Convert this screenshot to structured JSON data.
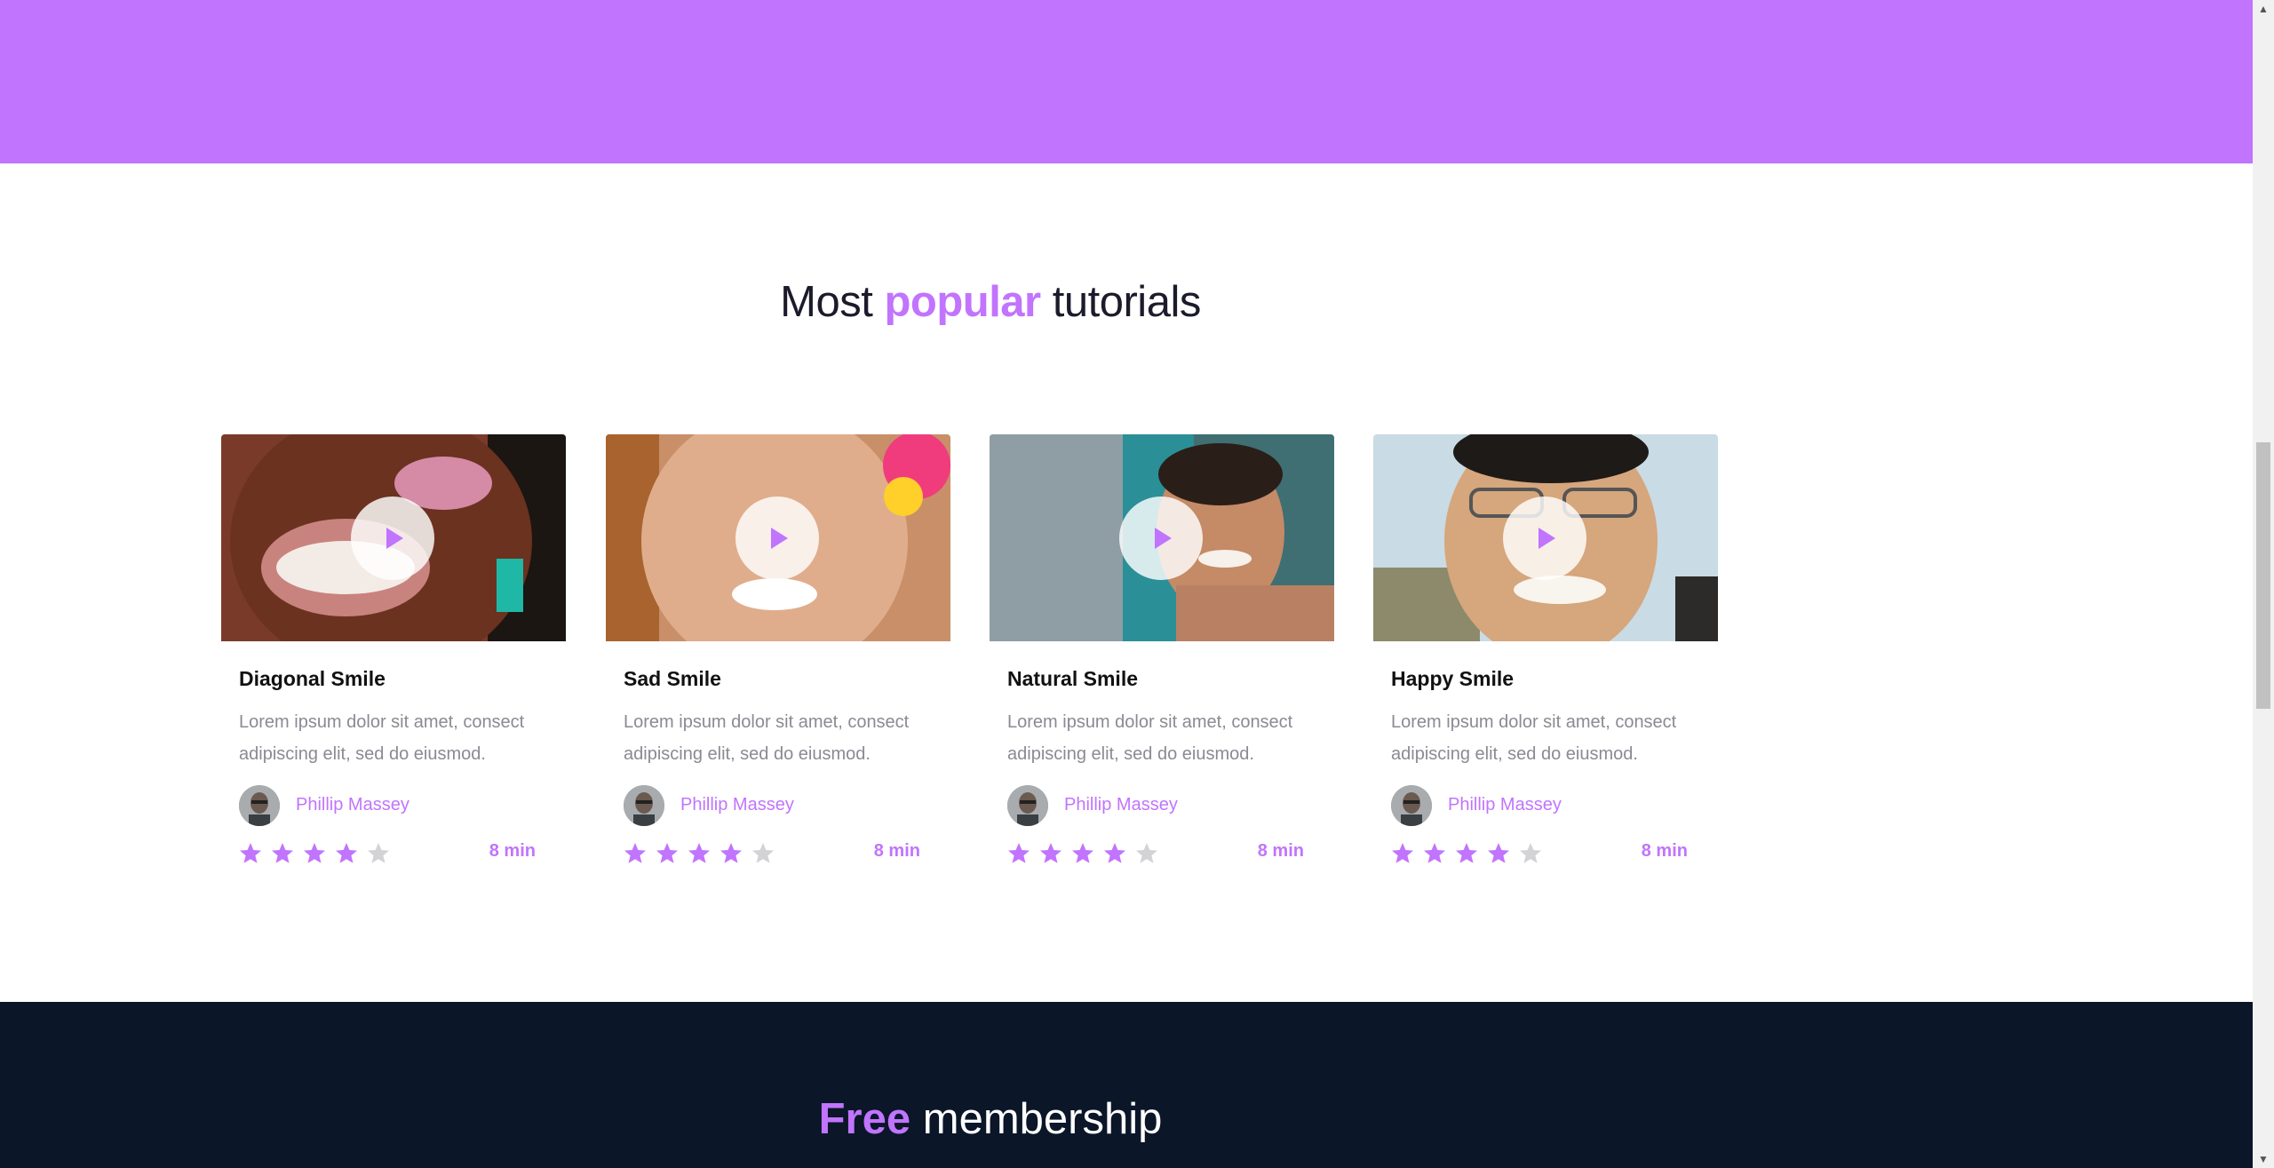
{
  "section": {
    "title_pre": "Most ",
    "title_accent": "popular",
    "title_post": " tutorials"
  },
  "cards": [
    {
      "title": "Diagonal Smile",
      "desc": "Lorem ipsum dolor sit amet, consect adipiscing elit, sed do eiusmod.",
      "author": "Phillip Massey",
      "rating": 4,
      "rating_max": 5,
      "duration": "8 min"
    },
    {
      "title": "Sad Smile",
      "desc": "Lorem ipsum dolor sit amet, consect adipiscing elit, sed do eiusmod.",
      "author": "Phillip Massey",
      "rating": 4,
      "rating_max": 5,
      "duration": "8 min"
    },
    {
      "title": "Natural Smile",
      "desc": "Lorem ipsum dolor sit amet, consect adipiscing elit, sed do eiusmod.",
      "author": "Phillip Massey",
      "rating": 4,
      "rating_max": 5,
      "duration": "8 min"
    },
    {
      "title": "Happy Smile",
      "desc": "Lorem ipsum dolor sit amet, consect adipiscing elit, sed do eiusmod.",
      "author": "Phillip Massey",
      "rating": 4,
      "rating_max": 5,
      "duration": "8 min"
    }
  ],
  "footer": {
    "title_accent": "Free",
    "title_post": " membership"
  },
  "colors": {
    "accent": "#c174fe",
    "dark_band": "#0b1628",
    "star_empty": "#d3d3d6",
    "text_muted": "#8a8a93"
  },
  "icons": {
    "play": "play-icon",
    "star": "star-icon",
    "avatar": "avatar"
  }
}
